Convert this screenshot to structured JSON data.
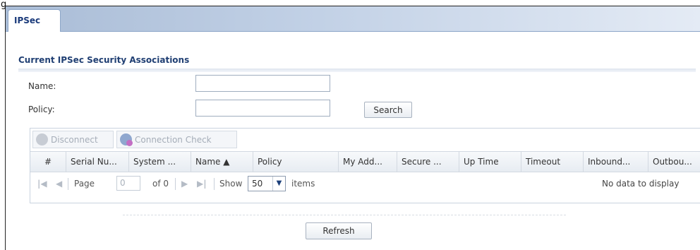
{
  "corner_glyph": "g",
  "tab": {
    "label": "IPSec"
  },
  "section": {
    "title": "Current IPSec Security Associations"
  },
  "filters": {
    "name_label": "Name:",
    "name_value": "",
    "policy_label": "Policy:",
    "policy_value": "",
    "search_label": "Search"
  },
  "toolbar": {
    "disconnect_label": "Disconnect",
    "connection_check_label": "Connection Check"
  },
  "table": {
    "columns": [
      "#",
      "Serial Nu...",
      "System ...",
      "Name ▲",
      "Policy",
      "My Add...",
      "Secure ...",
      "Up Time",
      "Timeout",
      "Inbound...",
      "Outbou..."
    ],
    "sorted_column": "Name"
  },
  "pager": {
    "page_label": "Page",
    "page_value": "0",
    "of_label": "of 0",
    "show_label": "Show",
    "page_size": "50",
    "items_label": "items",
    "empty_message": "No data to display"
  },
  "footer": {
    "refresh_label": "Refresh"
  },
  "colors": {
    "accent": "#1a3a7a",
    "tabbar": "#a9bcd6",
    "title": "#203f73"
  }
}
